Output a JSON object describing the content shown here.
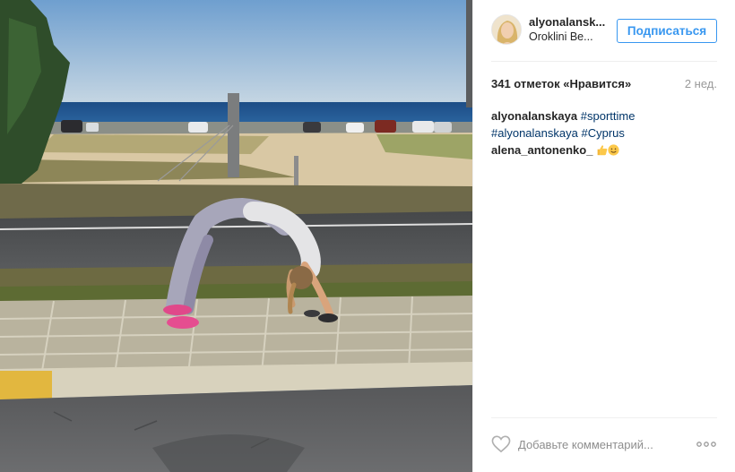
{
  "post": {
    "username": "alyonalansk...",
    "location": "Oroklini Be...",
    "follow_label": "Подписаться",
    "likes_text": "341 отметок «Нравится»",
    "time_ago": "2 нед."
  },
  "comments": [
    {
      "user": "alyonalanskaya",
      "tag1": "#sporttime",
      "tag2": "#alyonalanskaya",
      "tag3": "#Cyprus"
    },
    {
      "user": "alena_antonenko_"
    }
  ],
  "comment_bar": {
    "placeholder": "Добавьте комментарий..."
  },
  "icons": {
    "heart": "heart-outline-icon",
    "more": "more-options-icon",
    "thumbs_up": "thumbs-up-emoji",
    "smile": "smile-emoji"
  },
  "colors": {
    "accent": "#3897f0",
    "hashtag": "#003569",
    "muted": "#999999",
    "divider": "#efefef"
  }
}
